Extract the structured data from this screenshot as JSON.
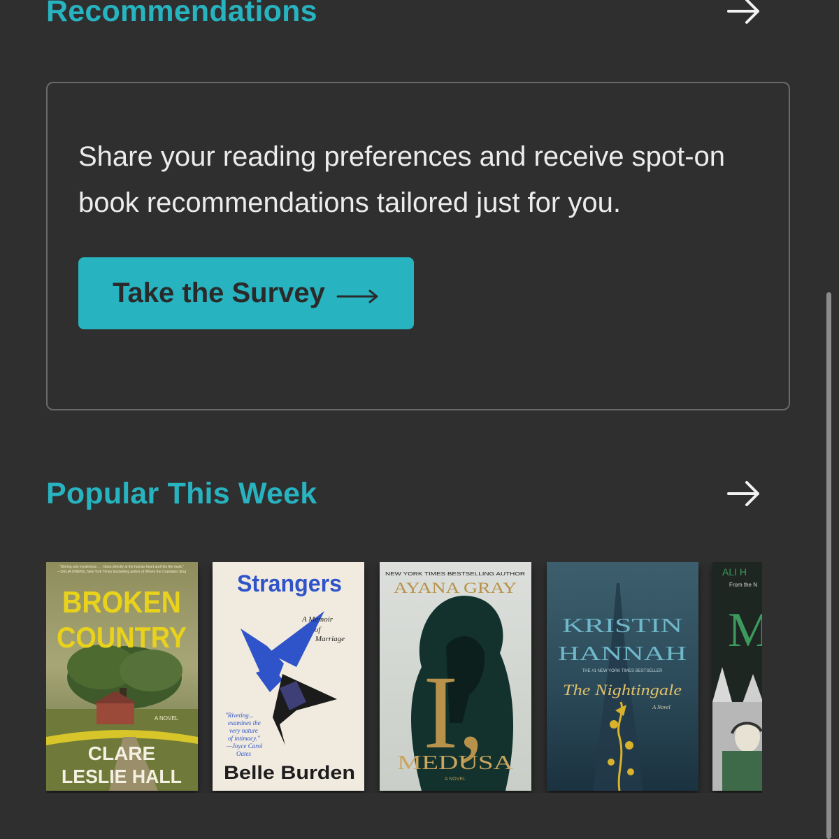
{
  "recommendations": {
    "title": "Recommendations",
    "survey": {
      "description": "Share your reading preferences and receive spot-on book recommendations tailored just for you.",
      "button_label": "Take the Survey"
    }
  },
  "popular": {
    "title": "Popular This Week",
    "books": [
      {
        "title_line1": "BROKEN",
        "title_line2": "COUNTRY",
        "subtitle": "A NOVEL",
        "author_line1": "CLARE",
        "author_line2": "LESLIE HALL",
        "blurb_line1": "\"Stirring and mysterious . . . Goes directly at the human heart and hits the mark.\"",
        "blurb_line2": "—DELIA OWENS, New York Times bestselling author of Where the Crawdads Sing",
        "colors": {
          "sky": "#8d8a55",
          "title": "#e9d21c"
        }
      },
      {
        "title": "Strangers",
        "subtitle_line1": "A Memoir",
        "subtitle_line2": "of",
        "subtitle_line3": "Marriage",
        "quote_line1": "\"Riveting...",
        "quote_line2": "examines the",
        "quote_line3": "very nature",
        "quote_line4": "of intimacy.\"",
        "quote_line5": "—Joyce Carol",
        "quote_line6": "Oates",
        "author": "Belle Burden",
        "colors": {
          "bg": "#f1ebdf",
          "accent": "#2f53c8"
        }
      },
      {
        "tagline": "NEW YORK TIMES BESTSELLING AUTHOR",
        "author": "AYANA GRAY",
        "title_mark": "I,",
        "title": "MEDUSA",
        "subtitle": "A NOVEL",
        "colors": {
          "bg": "#d7dbd7",
          "figure": "#13322d",
          "gold": "#b8924a"
        }
      },
      {
        "author_line1": "KRISTIN",
        "author_line2": "HANNAH",
        "tagline": "THE #1 NEW YORK TIMES BESTSELLER",
        "title": "The Nightingale",
        "subtitle": "A Novel",
        "colors": {
          "bg": "#2a4a5a",
          "gold": "#d9b22b",
          "title": "#e0c06a"
        }
      },
      {
        "author": "ALI H",
        "tagline": "From the N",
        "title_mark": "M",
        "colors": {
          "bg": "#1e2622",
          "green": "#3c9a5c"
        }
      }
    ]
  },
  "icons": {
    "recommendations_arrow": "arrow-right-icon",
    "popular_arrow": "arrow-right-icon",
    "survey_button_arrow": "long-arrow-right-icon"
  },
  "colors": {
    "background": "#2f2f2f",
    "accent": "#27b3bf",
    "text": "#ececec",
    "card_border": "#6a6a6a"
  }
}
